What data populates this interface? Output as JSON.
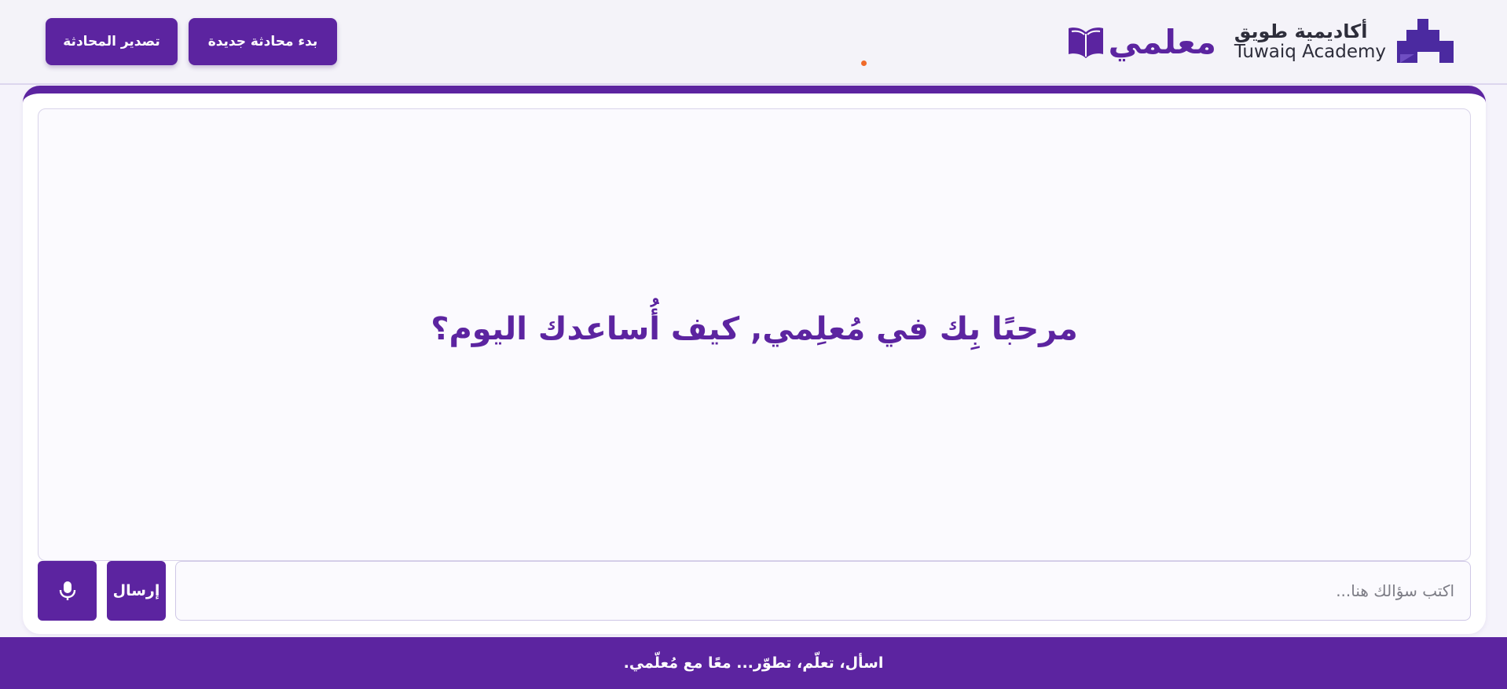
{
  "header": {
    "academy_name_ar": "أكاديمية طويق",
    "academy_name_en": "Tuwaiq Academy",
    "app_name": "معلمي",
    "new_chat_label": "بدء محادثة جديدة",
    "export_chat_label": "تصدير المحادثة"
  },
  "chat": {
    "welcome_message": "مرحبًا بِك في مُعلِمي, كيف أُساعدك اليوم؟"
  },
  "composer": {
    "input_placeholder": "اكتب سؤالك هنا...",
    "input_value": "",
    "send_label": "إرسال",
    "mic_icon": "microphone-icon"
  },
  "footer": {
    "tagline": "اسأل، تعلّم، تطوّر... معًا مع مُعلّمي."
  },
  "colors": {
    "primary": "#5c24a0",
    "status_dot": "#f06a2a",
    "background": "#f5f3fb"
  }
}
